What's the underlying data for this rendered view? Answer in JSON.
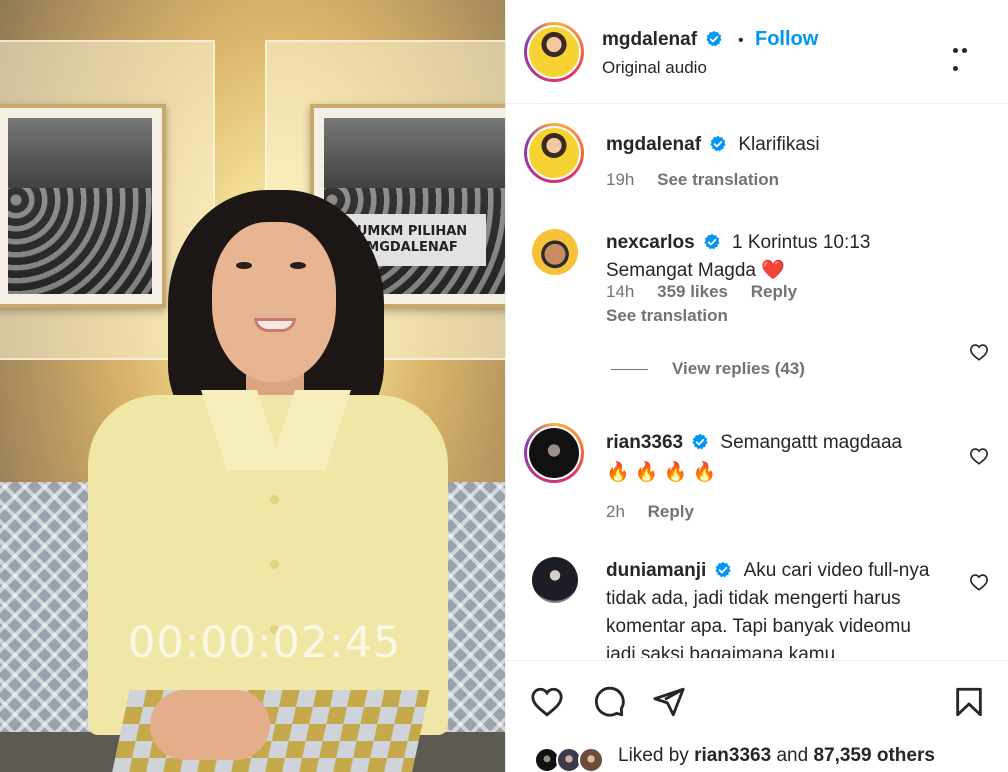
{
  "video": {
    "timecode": "00:00:02:45",
    "banner_text": "UMKM PILIHAN MGDALENAF"
  },
  "header": {
    "username": "mgdalenaf",
    "follow_label": "Follow",
    "separator": "•",
    "audio": "Original audio",
    "icons": {
      "verified": "verified-badge-icon",
      "more": "more-options-icon"
    }
  },
  "caption": {
    "username": "mgdalenaf",
    "text": "Klarifikasi",
    "time": "19h",
    "translate": "See translation"
  },
  "comments": [
    {
      "username": "nexcarlos",
      "text": "1 Korintus 10:13 Semangat Magda",
      "emoji": "❤️",
      "time": "14h",
      "likes": "359 likes",
      "reply": "Reply",
      "translate": "See translation",
      "view_replies": "View replies (43)"
    },
    {
      "username": "rian3363",
      "text": "Semangattt magdaaa",
      "emoji": "🔥 🔥 🔥 🔥",
      "time": "2h",
      "reply": "Reply"
    },
    {
      "username": "duniamanji",
      "text": "Aku cari video full-nya tidak ada, jadi tidak mengerti harus komentar apa. Tapi banyak videomu jadi saksi bagaimana kamu"
    }
  ],
  "footer": {
    "liked_prefix": "Liked by",
    "liked_user": "rian3363",
    "liked_and": "and",
    "liked_count": "87,359 others",
    "icons": [
      "like-icon",
      "comment-icon",
      "share-icon",
      "save-icon"
    ]
  },
  "colors": {
    "accent": "#0095f6",
    "text": "#262626",
    "secondary": "#737373",
    "verified": "#0095f6",
    "heart": "#ff3040"
  }
}
